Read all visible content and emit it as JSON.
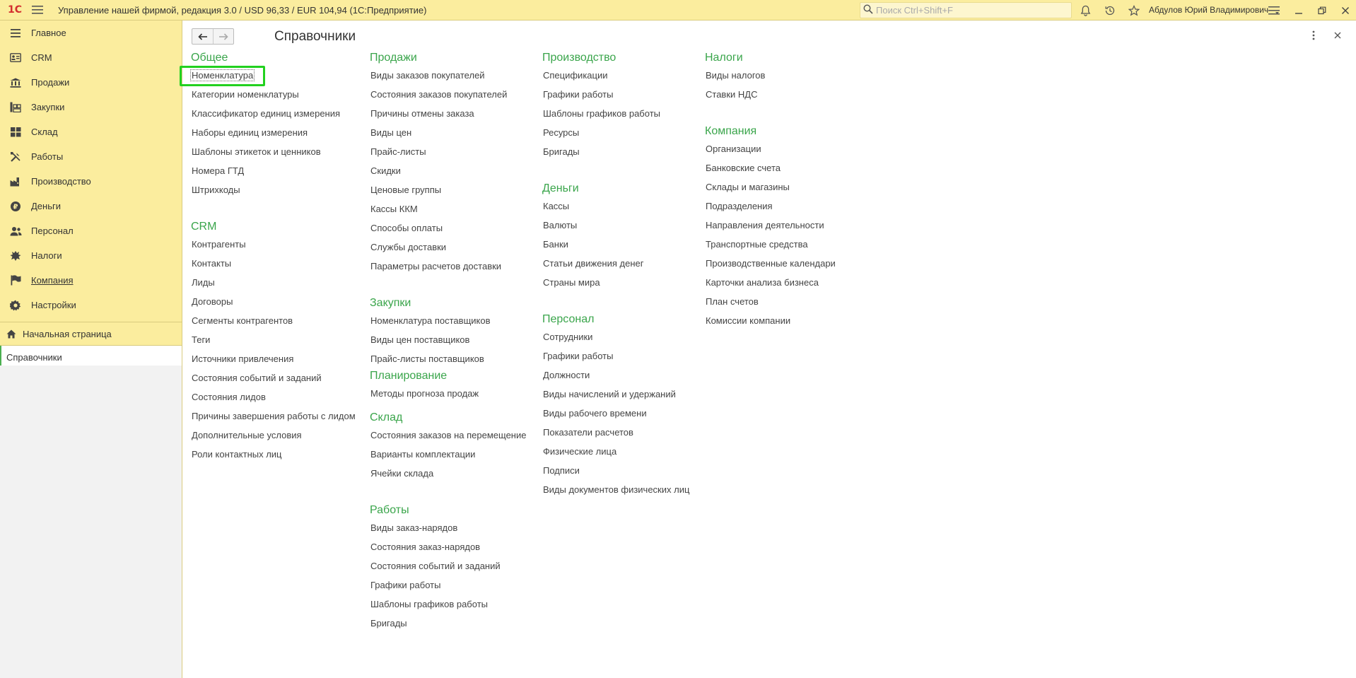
{
  "topbar": {
    "logo": "1С",
    "title": "Управление нашей фирмой, редакция 3.0 / USD 96,33 / EUR 104,94  (1С:Предприятие)",
    "search_placeholder": "Поиск Ctrl+Shift+F",
    "user": "Абдулов Юрий Владимирович"
  },
  "sidebar": {
    "items": [
      {
        "label": "Главное",
        "icon": "list-icon"
      },
      {
        "label": "CRM",
        "icon": "crm-icon"
      },
      {
        "label": "Продажи",
        "icon": "sales-icon"
      },
      {
        "label": "Закупки",
        "icon": "purchases-icon"
      },
      {
        "label": "Склад",
        "icon": "warehouse-icon"
      },
      {
        "label": "Работы",
        "icon": "tools-icon"
      },
      {
        "label": "Производство",
        "icon": "production-icon"
      },
      {
        "label": "Деньги",
        "icon": "money-icon"
      },
      {
        "label": "Персонал",
        "icon": "people-icon"
      },
      {
        "label": "Налоги",
        "icon": "taxes-icon"
      },
      {
        "label": "Компания",
        "icon": "flag-icon"
      },
      {
        "label": "Настройки",
        "icon": "gear-icon"
      }
    ],
    "open_windows": [
      {
        "label": "Начальная страница",
        "icon": "home-icon"
      },
      {
        "label": "Справочники"
      }
    ]
  },
  "main": {
    "title": "Справочники",
    "columns": [
      [
        {
          "title": "Общее",
          "items": [
            "Номенклатура",
            "Категории номенклатуры",
            "Классификатор единиц измерения",
            "Наборы единиц измерения",
            "Шаблоны этикеток и ценников",
            "Номера ГТД",
            "Штрихкоды"
          ]
        },
        {
          "title": "CRM",
          "items": [
            "Контрагенты",
            "Контакты",
            "Лиды",
            "Договоры",
            "Сегменты контрагентов",
            "Теги",
            "Источники привлечения",
            "Состояния событий и заданий",
            "Состояния лидов",
            "Причины завершения работы с лидом",
            "Дополнительные условия",
            "Роли контактных лиц"
          ]
        }
      ],
      [
        {
          "title": "Продажи",
          "items": [
            "Виды заказов покупателей",
            "Состояния заказов покупателей",
            "Причины отмены заказа",
            "Виды цен",
            "Прайс-листы",
            "Скидки",
            "Ценовые группы",
            "Кассы ККМ",
            "Способы оплаты",
            "Службы доставки",
            "Параметры расчетов доставки"
          ]
        },
        {
          "title": "Закупки",
          "items": [
            "Номенклатура поставщиков",
            "Виды цен поставщиков",
            "Прайс-листы поставщиков"
          ]
        },
        {
          "title": "Планирование",
          "items": [
            "Методы прогноза продаж"
          ]
        },
        {
          "title": "Склад",
          "items": [
            "Состояния заказов на перемещение",
            "Варианты комплектации",
            "Ячейки склада"
          ]
        },
        {
          "title": "Работы",
          "items": [
            "Виды заказ-нарядов",
            "Состояния заказ-нарядов",
            "Состояния событий и заданий",
            "Графики работы",
            "Шаблоны графиков работы",
            "Бригады"
          ]
        }
      ],
      [
        {
          "title": "Производство",
          "items": [
            "Спецификации",
            "Графики работы",
            "Шаблоны графиков работы",
            "Ресурсы",
            "Бригады"
          ]
        },
        {
          "title": "Деньги",
          "items": [
            "Кассы",
            "Валюты",
            "Банки",
            "Статьи движения денег",
            "Страны мира"
          ]
        },
        {
          "title": "Персонал",
          "items": [
            "Сотрудники",
            "Графики работы",
            "Должности",
            "Виды начислений и удержаний",
            "Виды рабочего времени",
            "Показатели расчетов",
            "Физические лица",
            "Подписи",
            "Виды документов физических лиц"
          ]
        }
      ],
      [
        {
          "title": "Налоги",
          "items": [
            "Виды налогов",
            "Ставки НДС"
          ]
        },
        {
          "title": "Компания",
          "items": [
            "Организации",
            "Банковские счета",
            "Склады и магазины",
            "Подразделения",
            "Направления деятельности",
            "Транспортные средства",
            "Производственные календари",
            "Карточки анализа бизнеса",
            "План счетов",
            "Комиссии компании"
          ]
        }
      ]
    ]
  }
}
